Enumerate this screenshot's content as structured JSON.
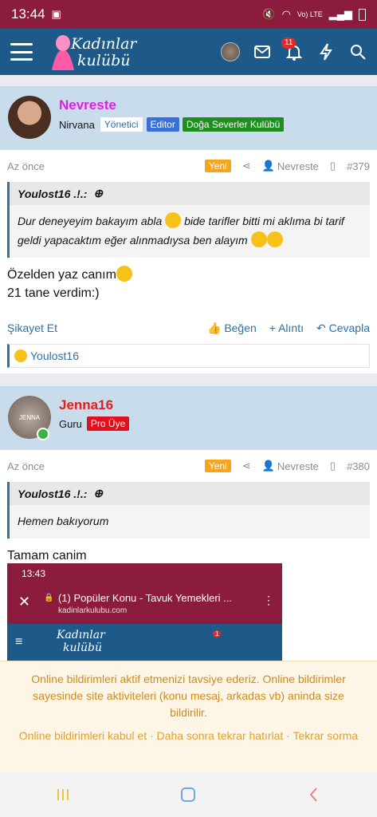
{
  "status_bar": {
    "time": "13:44",
    "signal_text": "Vo) LTE"
  },
  "header": {
    "logo_line1": "Kadınlar",
    "logo_line2": "kulübü",
    "notif_count": "11"
  },
  "posts": [
    {
      "username": "Nevreste",
      "username_color": "#e020e0",
      "user_title": "Nirvana",
      "badges": [
        {
          "label": "Yönetici",
          "bg": "#ffffff",
          "fg": "#2f6fa8",
          "border": "#c8d8e8"
        },
        {
          "label": "Editor",
          "bg": "#3a6fd8",
          "fg": "#ffffff",
          "border": "#3a6fd8"
        },
        {
          "label": "Doğa Severler Kulübü",
          "bg": "#1e8f1e",
          "fg": "#ffffff",
          "border": "#1e8f1e"
        }
      ],
      "time": "Az önce",
      "new_label": "Yeni",
      "author_short": "Nevreste",
      "post_no": "#379",
      "quote_author": "Youlost16 .!.:",
      "quote_text_1": "Dur deneyeyim bakayım abla",
      "quote_text_2": "bide tarifler bitti mi aklıma bi tarif geldi yapacaktım eğer alınmadıysa ben alayım",
      "body_line1": "Özelden yaz canım",
      "body_line2": "21 tane verdim:)",
      "report": "Şikayet Et",
      "like": "Beğen",
      "quote_btn": "Alıntı",
      "reply": "Cevapla",
      "reaction_user": "Youlost16"
    },
    {
      "username": "Jenna16",
      "username_color": "#e0201e",
      "user_title": "Guru",
      "badges": [
        {
          "label": "Pro Üye",
          "bg": "#e0101e",
          "fg": "#ffffff",
          "border": "#e0101e"
        }
      ],
      "time": "Az önce",
      "new_label": "Yeni",
      "author_short": "Nevreste",
      "post_no": "#380",
      "quote_author": "Youlost16 .!.:",
      "quote_text_1": "Hemen bakıyorum",
      "body_line1": "Tamam canim",
      "avatar_text": "JENNA"
    }
  ],
  "screenshot": {
    "time": "13:43",
    "tab_title": "(1) Popüler Konu - Tavuk Yemekleri ...",
    "tab_url": "kadinlarkulubu.com",
    "logo_line1": "Kadınlar",
    "logo_line2": "kulübü",
    "notif": "1"
  },
  "notice": {
    "message": "Online bildirimleri aktif etmenizi tavsiye ederiz. Online bildirimler sayesinde site aktiviteleri (konu mesaj, arkadas vb) aninda size bildirilir.",
    "accept": "Online bildirimleri kabul et",
    "later": "Daha sonra tekrar hatırlat",
    "again": "Tekrar sorma",
    "sep": " · "
  },
  "colors": {
    "status": "#8b1c3d",
    "header": "#1d5a8a",
    "author_bar": "#c9dcec",
    "link": "#2f6fa8"
  }
}
